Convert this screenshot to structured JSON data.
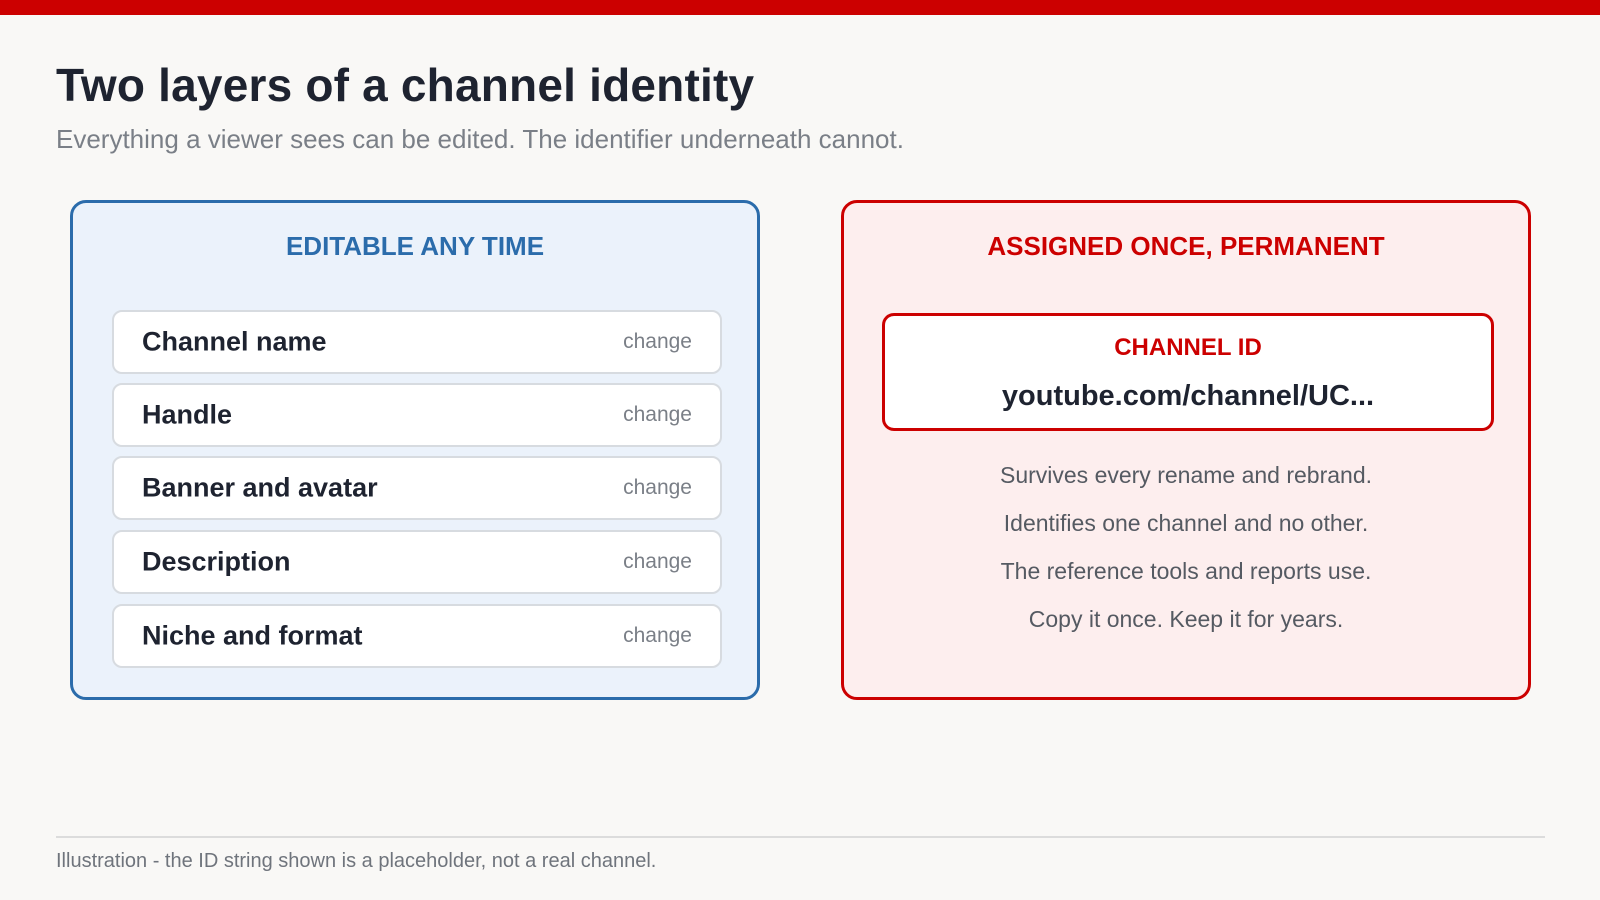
{
  "title": "Two layers of a channel identity",
  "subtitle": "Everything a viewer sees can be edited. The identifier underneath cannot.",
  "colors": {
    "accent_red": "#cc0000",
    "accent_blue": "#2b6cab",
    "background": "#f9f8f6"
  },
  "editable_panel": {
    "heading": "EDITABLE ANY TIME",
    "items": [
      {
        "label": "Channel name",
        "action": "change"
      },
      {
        "label": "Handle",
        "action": "change"
      },
      {
        "label": "Banner and avatar",
        "action": "change"
      },
      {
        "label": "Description",
        "action": "change"
      },
      {
        "label": "Niche and format",
        "action": "change"
      }
    ]
  },
  "permanent_panel": {
    "heading": "ASSIGNED ONCE, PERMANENT",
    "id_box": {
      "label": "CHANNEL ID",
      "value": "youtube.com/channel/UC..."
    },
    "facts": [
      "Survives every rename and rebrand.",
      "Identifies one channel and no other.",
      "The reference tools and reports use.",
      "Copy it once. Keep it for years."
    ]
  },
  "footnote": "Illustration - the ID string shown is a placeholder, not a real channel."
}
